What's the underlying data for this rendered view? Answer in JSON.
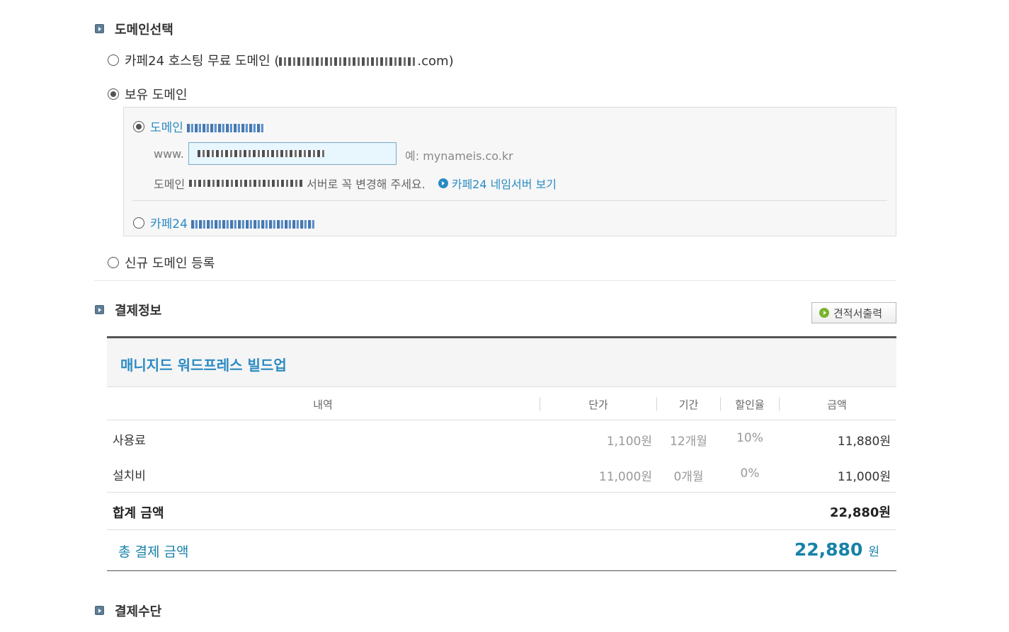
{
  "domain_section": {
    "title": "도메인선택",
    "option_free": {
      "label_prefix": "카페24 호스팅 무료 도메인 (",
      "label_suffix": ".com)"
    },
    "option_owned": {
      "label": "보유 도메인"
    },
    "option_new": {
      "label": "신규 도메인 등록"
    },
    "sub": {
      "option_connect": {
        "label": "도메인"
      },
      "www_prefix": "www.",
      "example_hint": "예: mynameis.co.kr",
      "nameserver_text_prefix": "도메인",
      "nameserver_text_suffix": "서버로 꼭 변경해 주세요.",
      "nameserver_link": "카페24 네임서버 보기",
      "option_cafe24": {
        "label": "카페24"
      }
    }
  },
  "payment_section": {
    "title": "결제정보",
    "quote_button": "견적서출력",
    "product_name": "매니지드 워드프레스 빌드업",
    "columns": [
      "내역",
      "단가",
      "기간",
      "할인율",
      "금액"
    ],
    "rows": [
      {
        "item": "사용료",
        "unit_price": "1,100원",
        "period": "12개월",
        "discount": "10%",
        "amount": "11,880원"
      },
      {
        "item": "설치비",
        "unit_price": "11,000원",
        "period": "0개월",
        "discount": "0%",
        "amount": "11,000원"
      }
    ],
    "subtotal_label": "합계 금액",
    "subtotal_value": "22,880원",
    "total_label": "총 결제 금액",
    "total_value": "22,880",
    "total_unit": "원"
  },
  "method_section": {
    "title": "결제수단"
  },
  "colors": {
    "accent_blue": "#2b8bc3",
    "total_teal": "#1782a8",
    "section_icon": "#5f7e95"
  }
}
